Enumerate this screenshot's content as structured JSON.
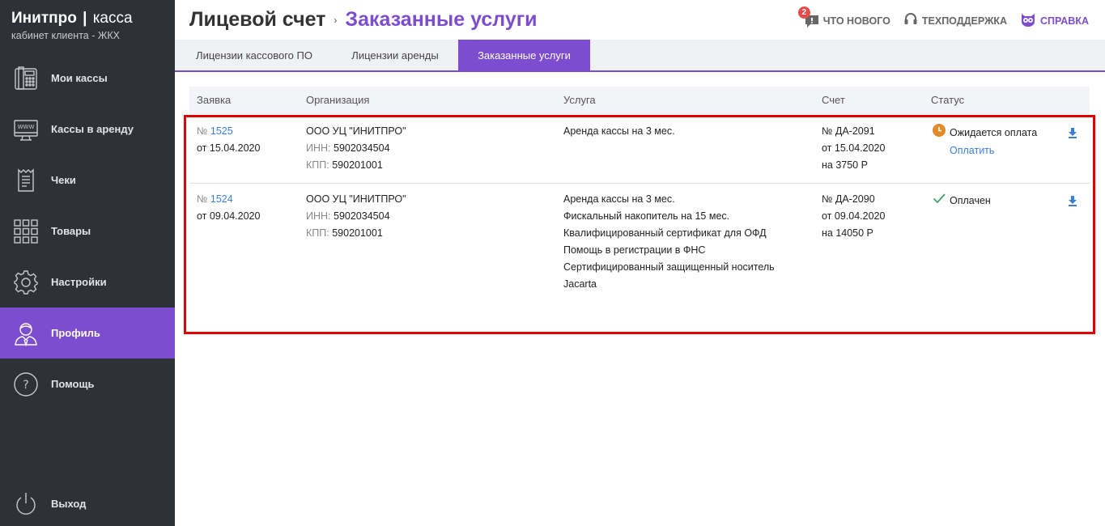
{
  "brand": {
    "name": "Инитпро",
    "separator": "|",
    "product": "касса",
    "subtitle": "кабинет клиента - ЖКХ"
  },
  "sidebar": {
    "items": [
      {
        "label": "Мои кассы",
        "icon": "fax-register-icon"
      },
      {
        "label": "Кассы в аренду",
        "icon": "www-monitor-icon"
      },
      {
        "label": "Чеки",
        "icon": "receipt-icon"
      },
      {
        "label": "Товары",
        "icon": "grid-icon"
      },
      {
        "label": "Настройки",
        "icon": "gear-icon"
      },
      {
        "label": "Профиль",
        "icon": "user-icon",
        "active": true
      },
      {
        "label": "Помощь",
        "icon": "question-icon"
      }
    ],
    "logout": {
      "label": "Выход",
      "icon": "power-icon"
    }
  },
  "header": {
    "breadcrumb_root": "Лицевой счет",
    "breadcrumb_separator": "›",
    "breadcrumb_current": "Заказанные услуги",
    "news": {
      "label": "ЧТО НОВОГО",
      "badge": "2"
    },
    "support": {
      "label": "ТЕХПОДДЕРЖКА"
    },
    "help": {
      "label": "СПРАВКА"
    }
  },
  "tabs": [
    {
      "label": "Лицензии кассового ПО",
      "active": false
    },
    {
      "label": "Лицензии аренды",
      "active": false
    },
    {
      "label": "Заказанные услуги",
      "active": true
    }
  ],
  "table": {
    "columns": [
      "Заявка",
      "Организация",
      "Услуга",
      "Счет",
      "Статус"
    ],
    "rows": [
      {
        "order_prefix": "№",
        "order_number": "1525",
        "order_date": "от 15.04.2020",
        "org_name": "ООО УЦ \"ИНИТПРО\"",
        "inn_label": "ИНН:",
        "inn": "5902034504",
        "kpp_label": "КПП:",
        "kpp": "590201001",
        "services": [
          "Аренда кассы на 3 мес."
        ],
        "invoice_number": "№ ДА-2091",
        "invoice_date": "от 15.04.2020",
        "invoice_sum": "на 3750 Р",
        "status": "Ожидается оплата",
        "status_icon": "clock-icon",
        "action": "Оплатить"
      },
      {
        "order_prefix": "№",
        "order_number": "1524",
        "order_date": "от 09.04.2020",
        "org_name": "ООО УЦ \"ИНИТПРО\"",
        "inn_label": "ИНН:",
        "inn": "5902034504",
        "kpp_label": "КПП:",
        "kpp": "590201001",
        "services": [
          "Аренда кассы на 3 мес.",
          "Фискальный накопитель на 15 мес.",
          "Квалифицированный сертификат для ОФД",
          "Помощь в регистрации в ФНС",
          "Сертифицированный защищенный носитель",
          "Jacarta"
        ],
        "invoice_number": "№ ДА-2090",
        "invoice_date": "от 09.04.2020",
        "invoice_sum": "на 14050 Р",
        "status": "Оплачен",
        "status_icon": "check-icon",
        "action": ""
      }
    ]
  },
  "colors": {
    "accent": "#7c4dce",
    "sidebar": "#2f3138",
    "link": "#3a7ed6",
    "highlight": "#e50000",
    "pending": "#e08a2c",
    "paid": "#3aa36b"
  }
}
